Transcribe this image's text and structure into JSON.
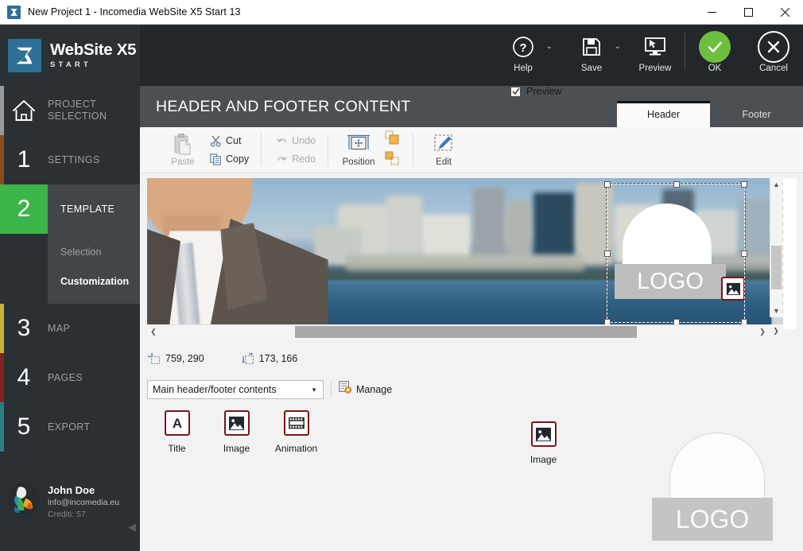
{
  "window": {
    "title": "New Project 1 - Incomedia WebSite X5 Start 13",
    "app_icon": "x5-logo-icon",
    "controls": {
      "minimize": "—",
      "maximize": "☐",
      "close": "✕"
    }
  },
  "brand": {
    "name": "WebSite X5",
    "edition": "START"
  },
  "top_actions": [
    {
      "id": "help",
      "label": "Help",
      "icon": "question-circle-icon",
      "has_caret": true
    },
    {
      "id": "save",
      "label": "Save",
      "icon": "floppy-disk-icon",
      "has_caret": true
    },
    {
      "id": "preview",
      "label": "Preview",
      "icon": "monitor-cursor-icon",
      "has_caret": false
    },
    {
      "id": "ok",
      "label": "OK",
      "icon": "check-circle-icon",
      "has_caret": false
    },
    {
      "id": "cancel",
      "label": "Cancel",
      "icon": "x-circle-icon",
      "has_caret": false
    }
  ],
  "sidebar": {
    "items": [
      {
        "num": "",
        "label": "PROJECT\nSELECTION",
        "label_line1": "PROJECT",
        "label_line2": "SELECTION",
        "icon": "home-icon",
        "accent": "#9b9b9b",
        "active": false
      },
      {
        "num": "1",
        "label": "SETTINGS",
        "accent": "#8a4b1e",
        "active": false
      },
      {
        "num": "2",
        "label": "TEMPLATE",
        "accent": "#3cb54a",
        "active": true
      },
      {
        "num": "3",
        "label": "MAP",
        "accent": "#c9b23a",
        "active": false
      },
      {
        "num": "4",
        "label": "PAGES",
        "accent": "#7d2420",
        "active": false
      },
      {
        "num": "5",
        "label": "EXPORT",
        "accent": "#2a7f86",
        "active": false
      }
    ],
    "submenu": [
      {
        "label": "Selection",
        "selected": false
      },
      {
        "label": "Customization",
        "selected": true
      }
    ],
    "user": {
      "name": "John Doe",
      "email": "info@incomedia.eu",
      "credits": "Crediti: 57",
      "avatar": "user-avatar"
    },
    "collapse_icon": "collapse-arrow-icon"
  },
  "main": {
    "title": "HEADER AND FOOTER CONTENT",
    "tabs": [
      {
        "label": "Header",
        "active": true
      },
      {
        "label": "Footer",
        "active": false
      }
    ],
    "toolbar": {
      "paste": {
        "label": "Paste",
        "icon": "clipboard-icon",
        "disabled": true
      },
      "cut": {
        "label": "Cut",
        "icon": "scissors-icon",
        "disabled": false
      },
      "copy": {
        "label": "Copy",
        "icon": "copy-icon",
        "disabled": false
      },
      "undo": {
        "label": "Undo",
        "icon": "undo-arrow-icon",
        "disabled": true
      },
      "redo": {
        "label": "Redo",
        "icon": "redo-arrow-icon",
        "disabled": true
      },
      "position": {
        "label": "Position",
        "icon": "position-move-icon",
        "disabled": false
      },
      "bring_front": {
        "icon": "bring-to-front-icon"
      },
      "send_back": {
        "icon": "send-to-back-icon"
      },
      "edit": {
        "label": "Edit",
        "icon": "pencil-edit-icon",
        "disabled": false
      }
    },
    "canvas": {
      "logo_text": "LOGO",
      "image_badge_icon": "image-icon",
      "selection_handles": 8,
      "scroll_left_icon": "chevron-left-icon",
      "scroll_right_icon": "chevron-right-icon",
      "scroll_up_icon": "chevron-up-icon",
      "scroll_down_icon": "chevron-down-icon",
      "resize_grip_icon": "resize-grip-icon"
    },
    "coordinates": {
      "position": {
        "icon": "position-marker-icon",
        "value": "759, 290"
      },
      "size": {
        "icon": "size-marker-icon",
        "value": "173, 166"
      }
    },
    "contents_select": {
      "value": "Main header/footer contents",
      "caret_icon": "chevron-down-icon",
      "options": [
        "Main header/footer contents"
      ]
    },
    "manage": {
      "label": "Manage",
      "icon": "manage-gear-icon"
    },
    "preview_checkbox": {
      "label": "Preview",
      "checked": true,
      "icon": "checkmark-icon"
    },
    "palette": [
      {
        "label": "Title",
        "icon": "letter-a-icon"
      },
      {
        "label": "Image",
        "icon": "image-icon"
      },
      {
        "label": "Animation",
        "icon": "film-strip-icon"
      }
    ],
    "preview_panel": {
      "object": {
        "label": "Image",
        "icon": "image-icon"
      },
      "logo_text": "LOGO"
    }
  },
  "colors": {
    "accent_green": "#3cb54a",
    "dark_nav": "#2b3034",
    "header_bar": "#4b5055",
    "app_header": "#22272b",
    "maroon": "#7b1418",
    "ok_green": "#6fbf3f"
  }
}
